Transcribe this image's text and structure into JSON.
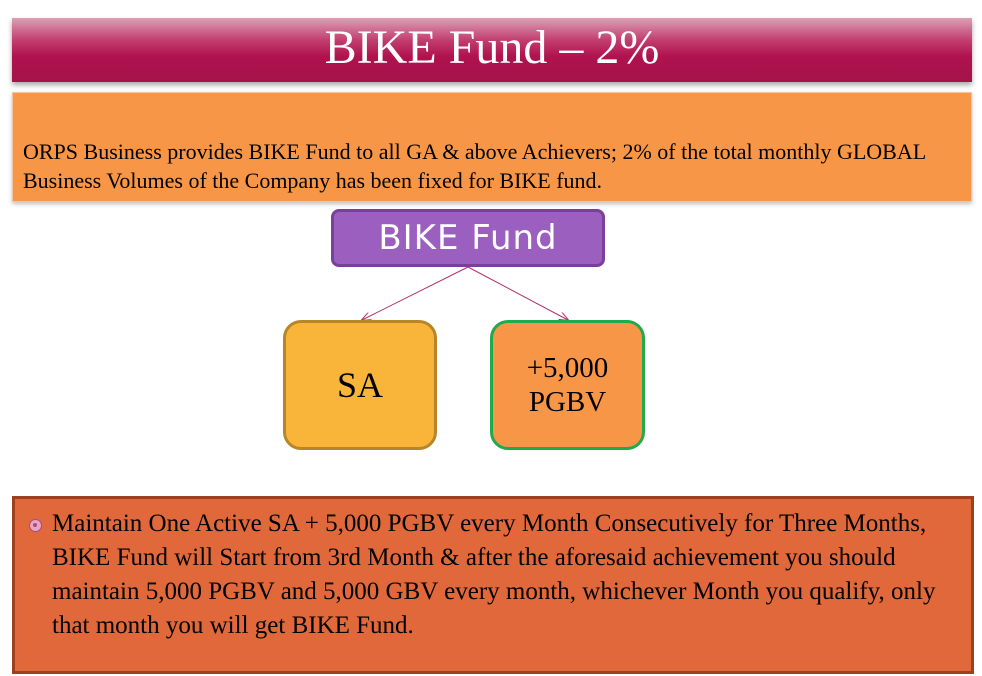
{
  "title": "BIKE Fund – 2%",
  "intro_text": "ORPS Business provides BIKE Fund to all GA & above Achievers; 2% of the total monthly GLOBAL  Business Volumes of the Company has been fixed for BIKE fund.",
  "diagram": {
    "root": "BIKE Fund",
    "child_left": "SA",
    "child_right_line1": "+5,000",
    "child_right_line2": "PGBV"
  },
  "rule_text": "Maintain One Active SA  + 5,000 PGBV every Month Consecutively for Three Months, BIKE Fund will Start from 3rd Month & after the aforesaid achievement you should maintain 5,000 PGBV  and 5,000 GBV every month, whichever Month you qualify, only that month you will get BIKE Fund.",
  "colors": {
    "title_banner": "#b0124e",
    "intro_fill": "#f79646",
    "root_fill": "#9b5fc0",
    "sa_fill": "#f9b43a",
    "pgbv_fill": "#f79646",
    "pgbv_border": "#22a94e",
    "rule_fill": "#e0683a"
  }
}
